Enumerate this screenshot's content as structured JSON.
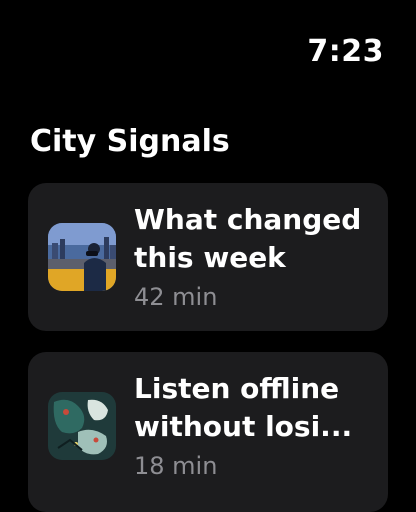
{
  "status": {
    "time": "7:23"
  },
  "screen": {
    "title": "City Signals"
  },
  "episodes": [
    {
      "title_line1": "What changed",
      "title_line2": "this week",
      "duration": "42 min",
      "artwork": "city-skyline-photo"
    },
    {
      "title_line1": "Listen offline",
      "title_line2": "without losi...",
      "duration": "18 min",
      "artwork": "abstract-map-art"
    }
  ]
}
